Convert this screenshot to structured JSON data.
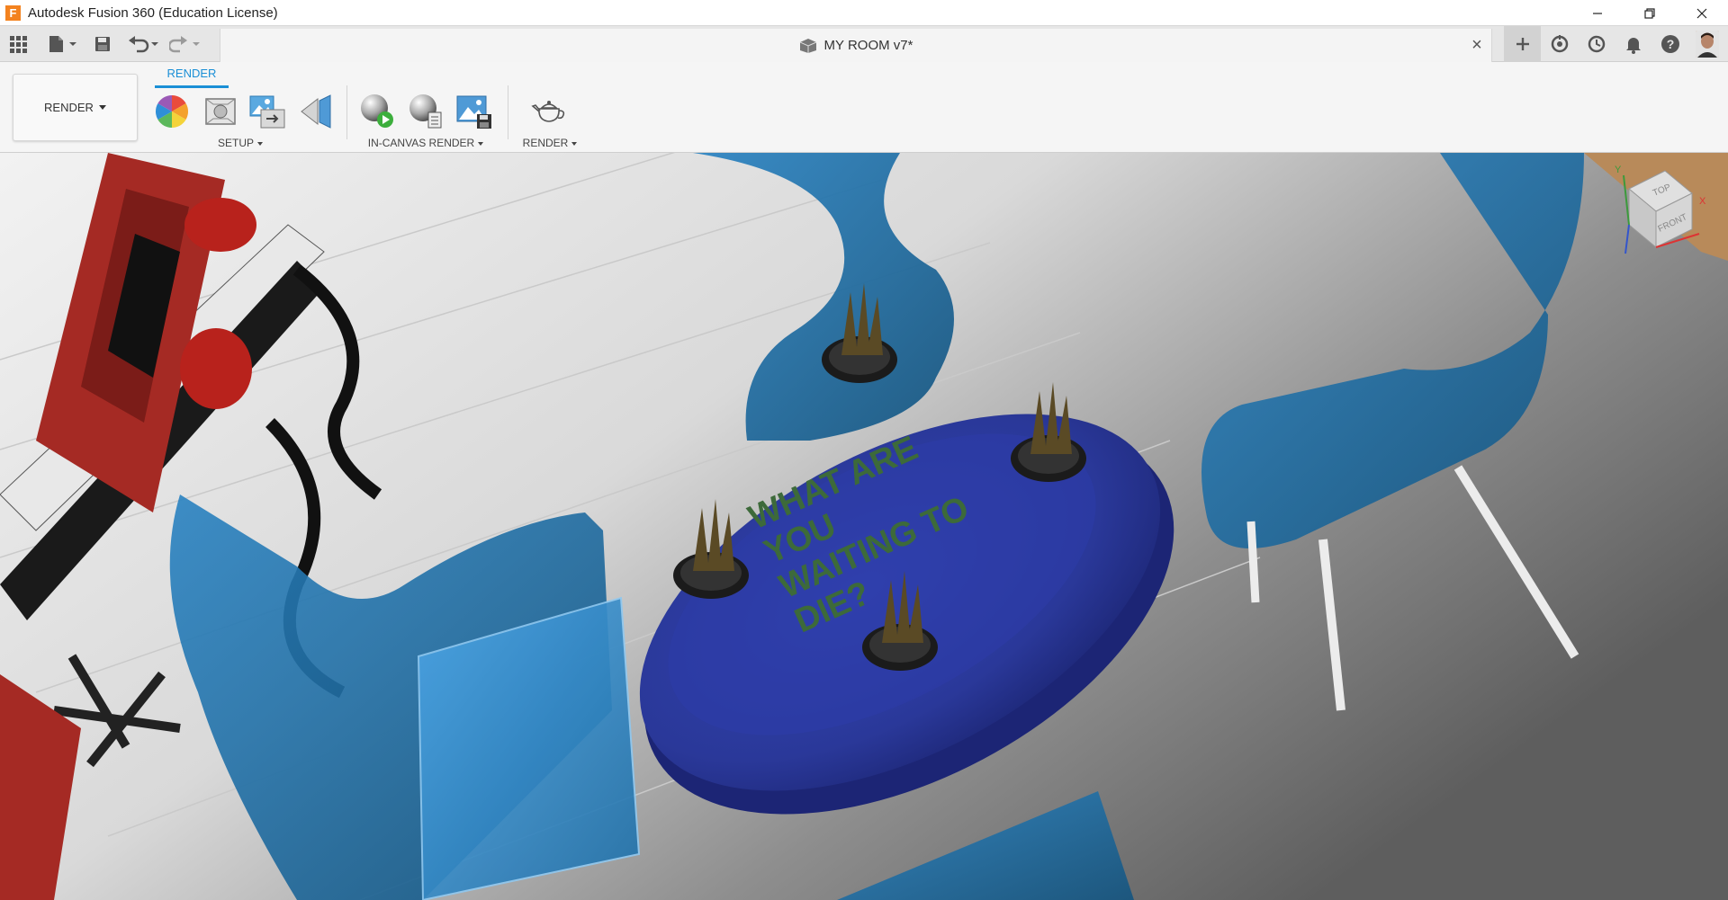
{
  "window": {
    "title": "Autodesk Fusion 360 (Education License)",
    "logo_letter": "F"
  },
  "appbar": {
    "document_title": "MY ROOM v7*"
  },
  "toolbar": {
    "workspace_label": "RENDER",
    "active_tab": "RENDER",
    "groups": {
      "setup": "SETUP",
      "in_canvas_render": "IN-CANVAS RENDER",
      "render": "RENDER"
    }
  },
  "canvas": {
    "table_text_lines": [
      "WHAT ARE",
      "YOU",
      "WAITING TO",
      "DIE?"
    ],
    "view_cube": {
      "top": "TOP",
      "front": "FRONT",
      "axis_x": "X",
      "axis_y": "Y"
    }
  },
  "colors": {
    "accent": "#1a8fd6",
    "table_blue": "#2f3fa8",
    "chair_blue": "#1e6fa8",
    "table_text": "#3d6a3a",
    "red_panel": "#a52a24"
  }
}
